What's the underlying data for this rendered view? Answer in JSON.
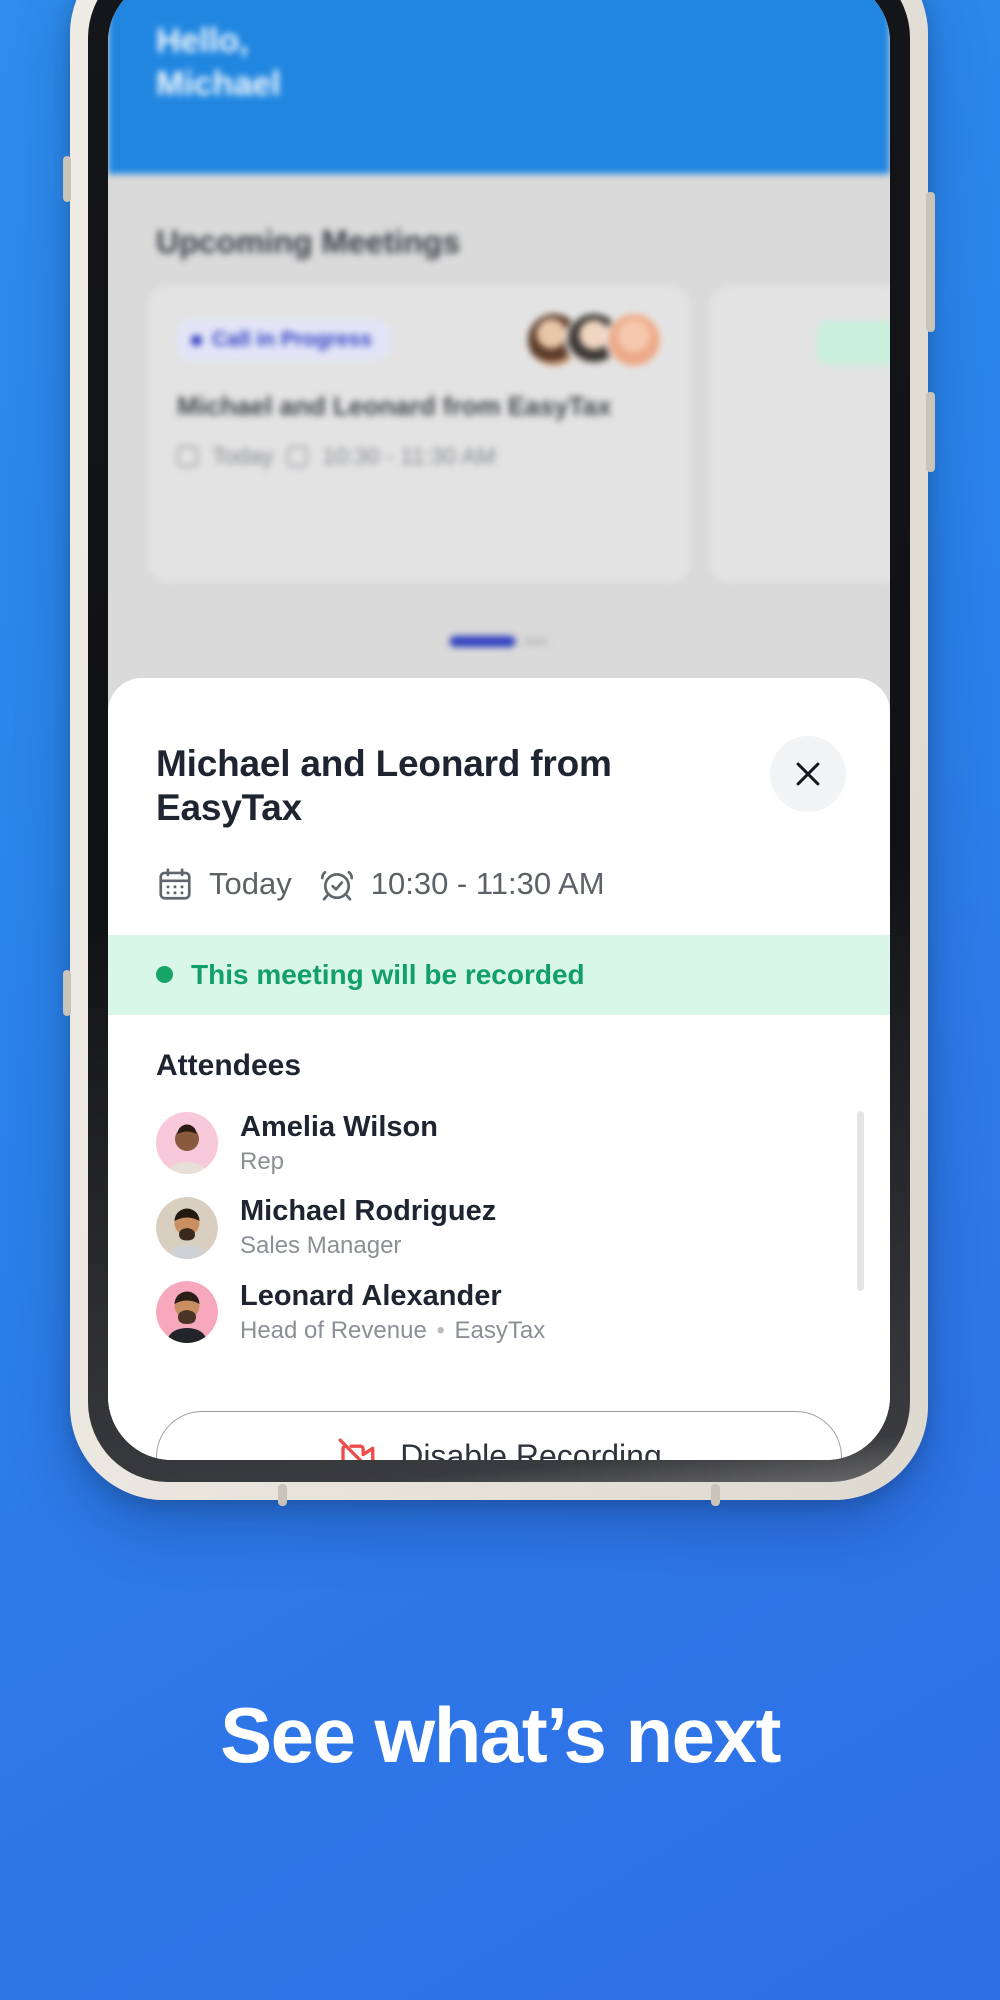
{
  "background": {
    "color": "#2a85ea"
  },
  "app": {
    "header": {
      "greeting_line1": "Hello,",
      "greeting_line2": "Michael",
      "color": "#2086e0"
    },
    "section_title": "Upcoming Meetings",
    "meeting_card": {
      "status_chip": "Call in Progress",
      "status_color": "#3340c4",
      "title": "Michael and Leonard from EasyTax",
      "day": "Today",
      "time": "10:30 - 11:30 AM"
    },
    "pager": {
      "active_index": 0,
      "count": 2
    }
  },
  "sheet": {
    "title": "Michael and Leonard from EasyTax",
    "close_label": "Close",
    "meta": {
      "day": "Today",
      "time": "10:30 - 11:30 AM"
    },
    "recording_banner": {
      "text": "This meeting will be recorded",
      "color": "#12a06a",
      "background": "#d9f7e9"
    },
    "attendees_heading": "Attendees",
    "attendees": [
      {
        "name": "Amelia Wilson",
        "role": "Rep",
        "company": "",
        "avatar_bg": "#f7c9da"
      },
      {
        "name": "Michael Rodriguez",
        "role": "Sales Manager",
        "company": "",
        "avatar_bg": "#d9cfc0"
      },
      {
        "name": "Leonard Alexander",
        "role": "Head of Revenue",
        "company": "EasyTax",
        "avatar_bg": "#f7a8bd"
      }
    ],
    "footer_button": {
      "label": "Disable Recording",
      "icon": "video-off-icon",
      "icon_color": "#ef4b4b"
    }
  },
  "caption": {
    "text": "See what’s next"
  }
}
